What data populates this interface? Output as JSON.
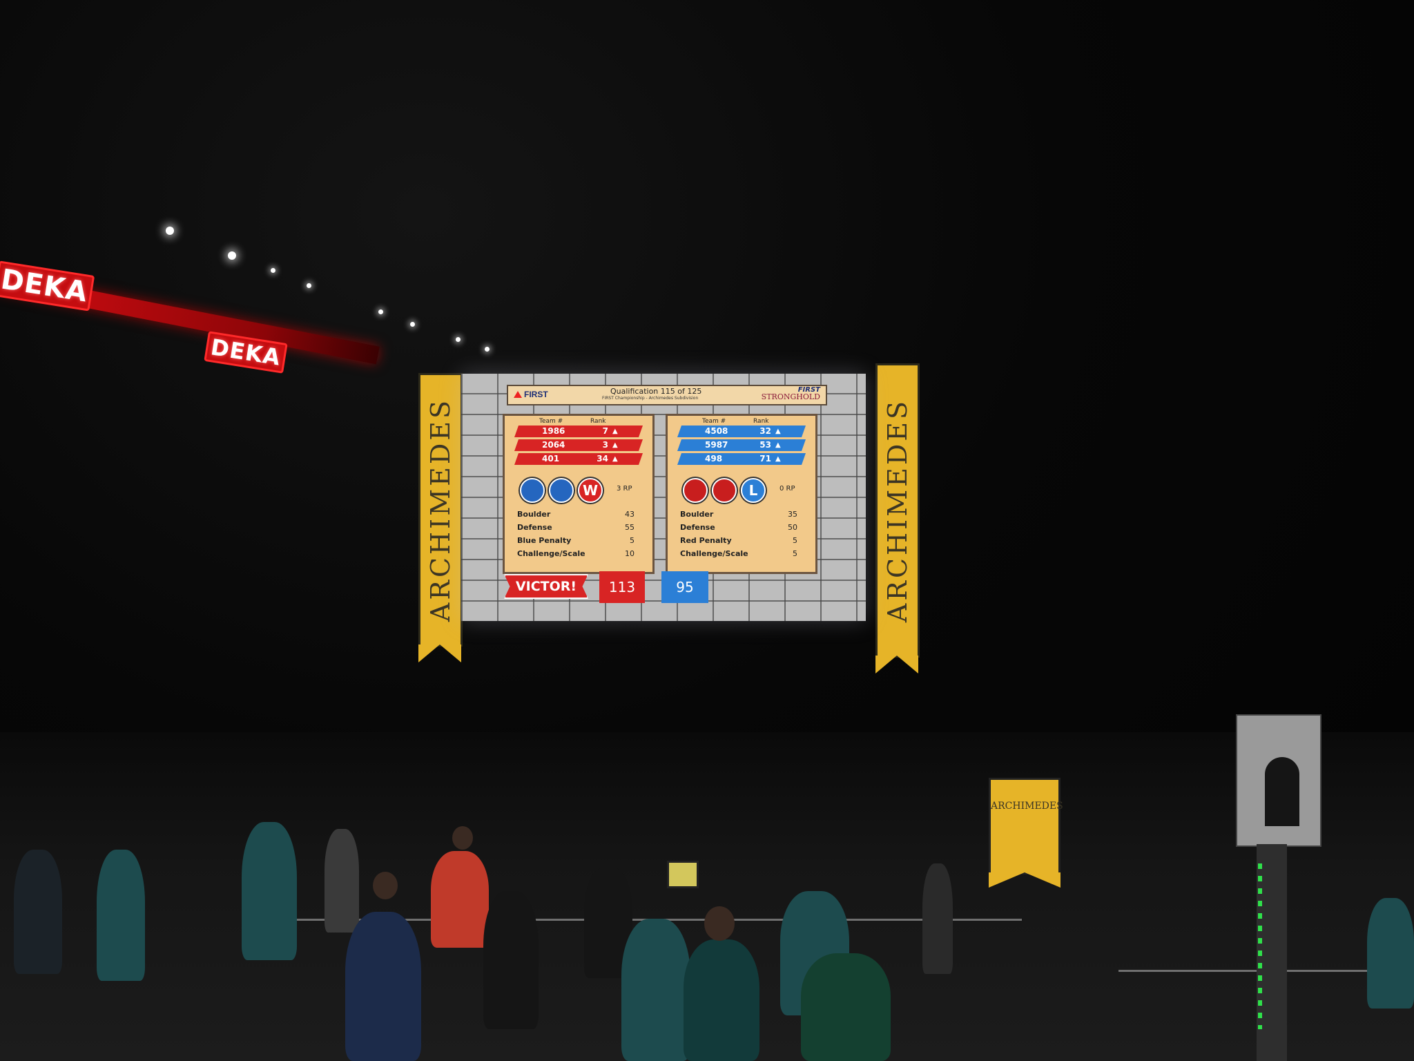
{
  "arena": {
    "sponsor_signs": [
      "DEKA",
      "DEKA"
    ],
    "banners": [
      "ARCHIMEDES",
      "ARCHIMEDES"
    ],
    "floor_flag": "ARCHIMEDES"
  },
  "scoreboard": {
    "logo": "FIRST",
    "title": "Qualification 115 of 125",
    "subtitle": "FIRST Championship - Archimedes Subdivision",
    "brand_line1": "FIRST",
    "brand_line2": "STRONGHOLD",
    "red": {
      "header_team": "Team #",
      "header_rank": "Rank",
      "teams": [
        {
          "team": "1986",
          "rank": "7",
          "arrow": "▲"
        },
        {
          "team": "2064",
          "rank": "3",
          "arrow": "▲"
        },
        {
          "team": "401",
          "rank": "34",
          "arrow": "▲"
        }
      ],
      "result_letter": "W",
      "rp": "3 RP",
      "breakdown": [
        {
          "label": "Boulder",
          "value": "43"
        },
        {
          "label": "Defense",
          "value": "55"
        },
        {
          "label": "Blue Penalty",
          "value": "5"
        },
        {
          "label": "Challenge/Scale",
          "value": "10"
        }
      ],
      "victor_label": "VICTOR!",
      "total": "113"
    },
    "blue": {
      "header_team": "Team #",
      "header_rank": "Rank",
      "teams": [
        {
          "team": "4508",
          "rank": "32",
          "arrow": "▲"
        },
        {
          "team": "5987",
          "rank": "53",
          "arrow": "▲"
        },
        {
          "team": "498",
          "rank": "71",
          "arrow": "▲"
        }
      ],
      "result_letter": "L",
      "rp": "0 RP",
      "breakdown": [
        {
          "label": "Boulder",
          "value": "35"
        },
        {
          "label": "Defense",
          "value": "50"
        },
        {
          "label": "Red Penalty",
          "value": "5"
        },
        {
          "label": "Challenge/Scale",
          "value": "5"
        }
      ],
      "total": "95"
    },
    "colors": {
      "red": "#d82424",
      "blue": "#2b7fd6",
      "panel": "#f2c98a",
      "banner": "#e6b428"
    }
  }
}
